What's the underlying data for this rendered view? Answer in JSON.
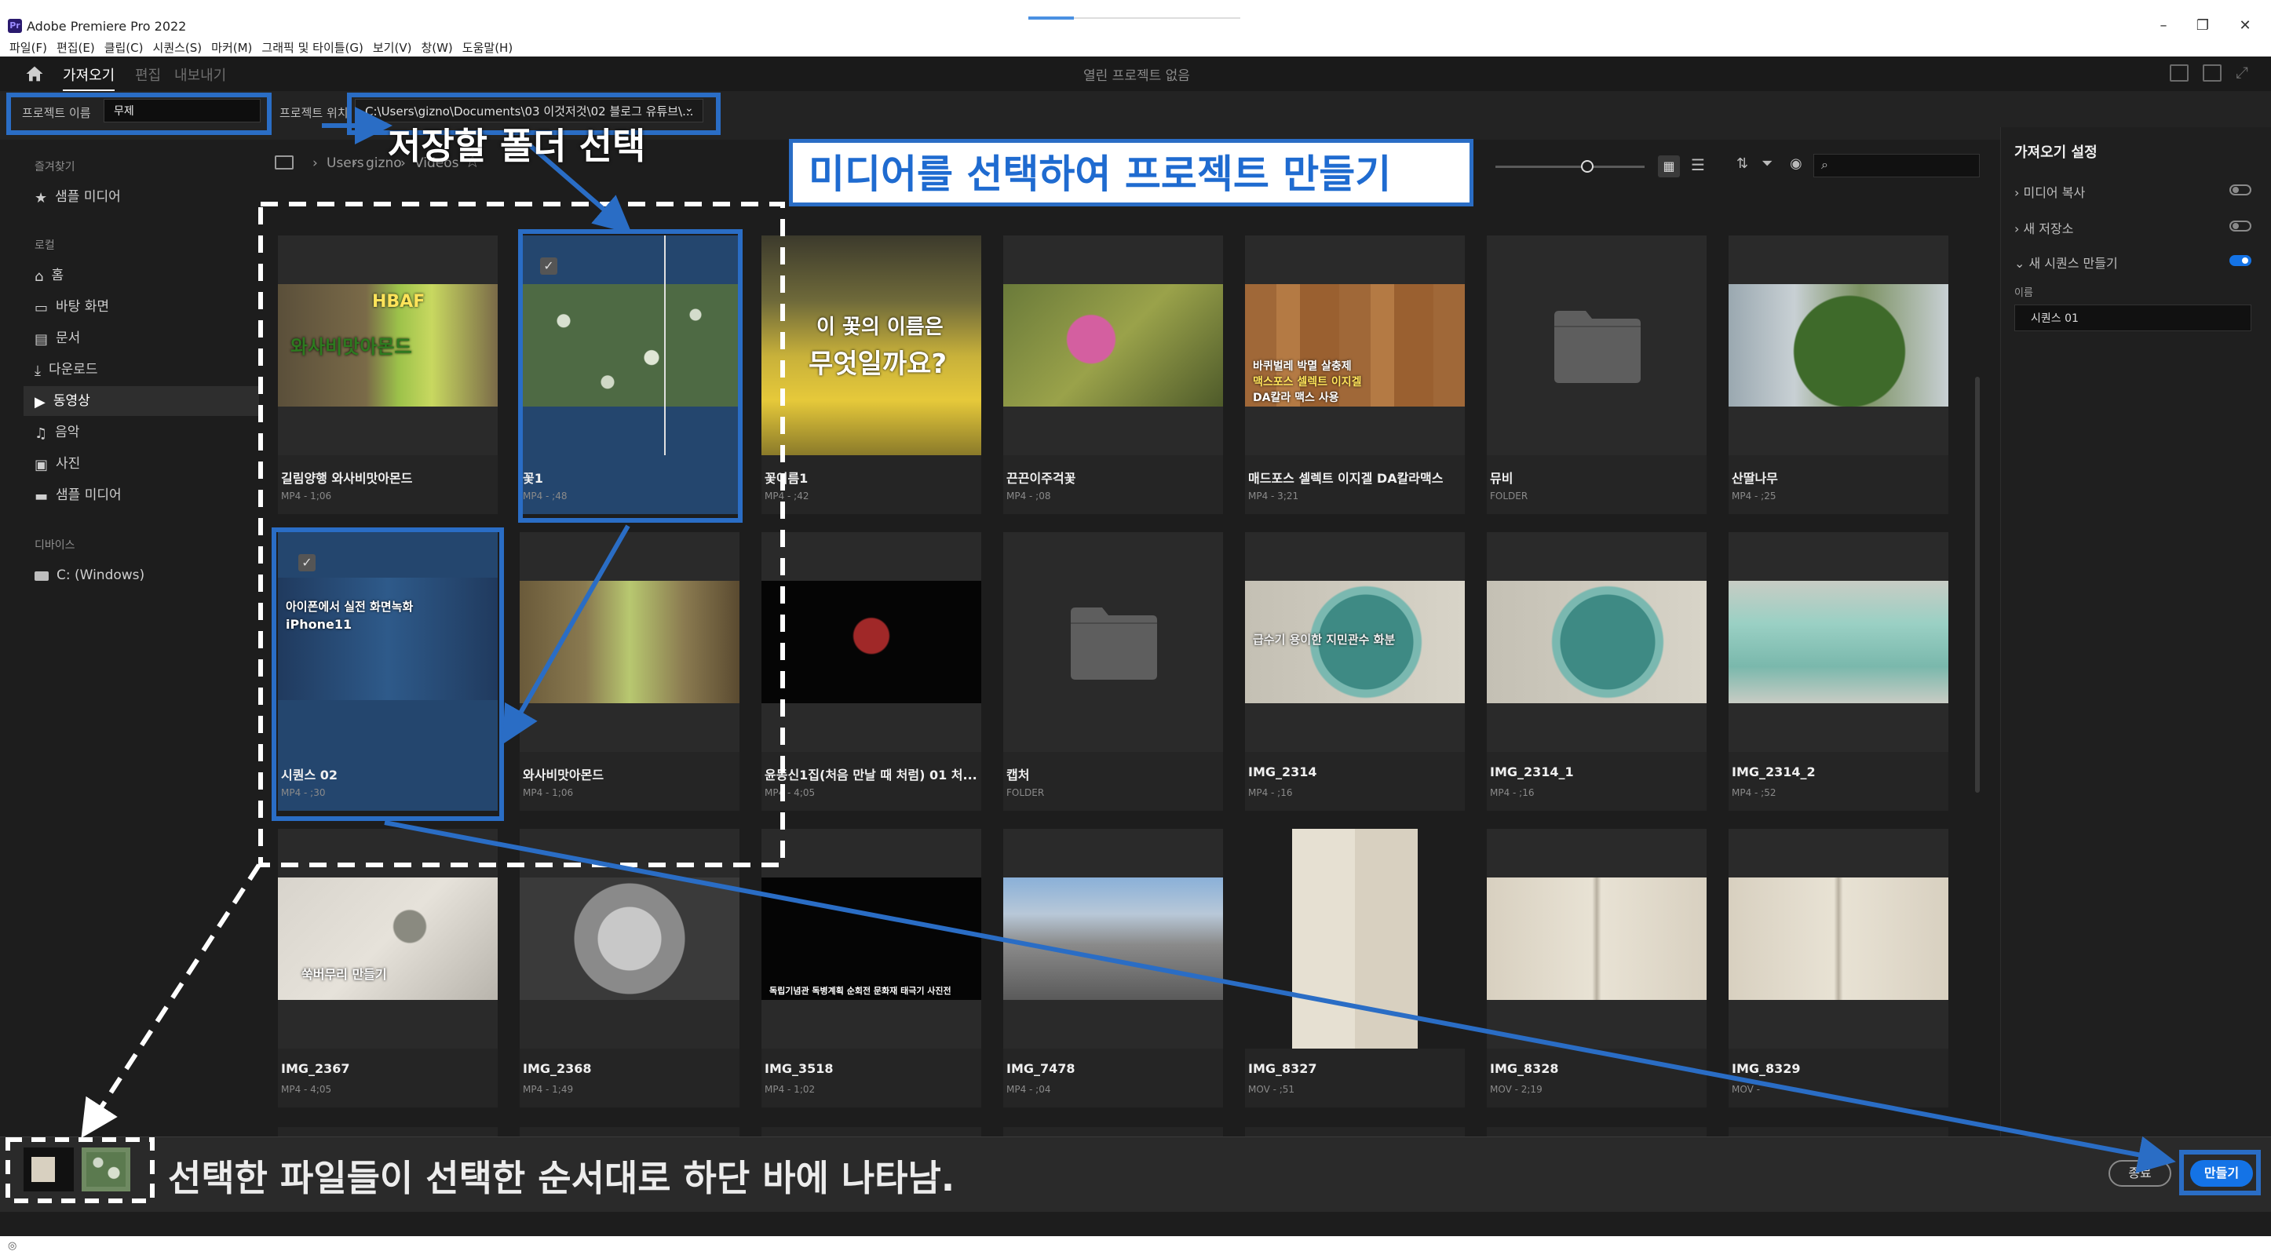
{
  "app": {
    "title": "Adobe Premiere Pro 2022",
    "icon": "Pr"
  },
  "menu": [
    "파일(F)",
    "편집(E)",
    "클립(C)",
    "시퀀스(S)",
    "마커(M)",
    "그래픽 및 타이틀(G)",
    "보기(V)",
    "창(W)",
    "도움말(H)"
  ],
  "header": {
    "tabs": [
      {
        "label": "가져오기",
        "active": true
      },
      {
        "label": "편집",
        "active": false
      },
      {
        "label": "내보내기",
        "active": false
      }
    ],
    "center_title": "열린 프로젝트 없음"
  },
  "project": {
    "name_label": "프로젝트 이름",
    "name_value": "무제",
    "location_label": "프로젝트 위치",
    "location_value": "C:\\Users\\gizno\\Documents\\03 이것저것\\02 블로그 유튜브\\..."
  },
  "sidebar": {
    "favorites_head": "즐겨찾기",
    "favorites": [
      {
        "label": "샘플 미디어",
        "icon": "star-icon"
      }
    ],
    "local_head": "로컬",
    "local": [
      {
        "label": "홈",
        "icon": "home-icon"
      },
      {
        "label": "바탕 화면",
        "icon": "monitor-icon"
      },
      {
        "label": "문서",
        "icon": "document-icon"
      },
      {
        "label": "다운로드",
        "icon": "download-icon"
      },
      {
        "label": "동영상",
        "icon": "video-icon",
        "selected": true
      },
      {
        "label": "음악",
        "icon": "music-icon"
      },
      {
        "label": "사진",
        "icon": "image-icon"
      },
      {
        "label": "샘플 미디어",
        "icon": "folder-icon"
      }
    ],
    "devices_head": "디바이스",
    "devices": [
      {
        "label": "C: (Windows)",
        "icon": "drive-icon"
      }
    ]
  },
  "breadcrumb": [
    "Users",
    "gizno",
    "Videos"
  ],
  "media": [
    {
      "name": "길림양행 와사비맛아몬드",
      "meta": "MP4 - 1;06"
    },
    {
      "name": "꽃1",
      "meta": "MP4 - ;48",
      "selected": true
    },
    {
      "name": "꽃이름1",
      "meta": "MP4 - ;42"
    },
    {
      "name": "끈끈이주걱꽃",
      "meta": "MP4 - ;08"
    },
    {
      "name": "매드포스 셀렉트 이지겔 DA칼라맥스",
      "meta": "MP4 - 3;21"
    },
    {
      "name": "뮤비",
      "meta": "FOLDER"
    },
    {
      "name": "산딸나무",
      "meta": "MP4 - ;25"
    },
    {
      "name": "시퀀스 02",
      "meta": "MP4 - ;30",
      "selected": true
    },
    {
      "name": "와사비맛아몬드",
      "meta": "MP4 - 1;06"
    },
    {
      "name": "윤동신1집(처음 만날 때 처럼) 01 처...",
      "meta": "MP4 - 4;05"
    },
    {
      "name": "캡처",
      "meta": "FOLDER"
    },
    {
      "name": "IMG_2314",
      "meta": "MP4 - ;16"
    },
    {
      "name": "IMG_2314_1",
      "meta": "MP4 - ;16"
    },
    {
      "name": "IMG_2314_2",
      "meta": "MP4 - ;52"
    },
    {
      "name": "IMG_2367",
      "meta": "MP4 - 4;05"
    },
    {
      "name": "IMG_2368",
      "meta": "MP4 - 1;49"
    },
    {
      "name": "IMG_3518",
      "meta": "MP4 - 1;02"
    },
    {
      "name": "IMG_7478",
      "meta": "MP4 - ;04"
    },
    {
      "name": "IMG_8327",
      "meta": "MOV - ;51"
    },
    {
      "name": "IMG_8328",
      "meta": "MOV - 2;19"
    },
    {
      "name": "IMG_8329",
      "meta": "MOV - "
    }
  ],
  "thumb_text": {
    "t1a": "HBAF",
    "t1b": "와사비맛아몬드",
    "t3a": "이 꽃의 이름은",
    "t3b": "무엇일까요?",
    "t5a": "바퀴벌레 박멸 살충제",
    "t5b": "맥스포스 셀렉트 이지겔",
    "t5c": "DA칼라 맥스 사용",
    "t8a": "아이폰에서 실전 화면녹화",
    "t8b": "iPhone11",
    "t12": "급수기 용이한 지민관수 화분",
    "t15": "쑥버무리 만들기",
    "t17": "독립기념관 독병계획 순회전 문화재 태극기 사진전"
  },
  "right_panel": {
    "title": "가져오기 설정",
    "rows": [
      {
        "label": "미디어 복사",
        "on": false
      },
      {
        "label": "새 저장소",
        "on": false
      },
      {
        "label": "새 시퀀스 만들기",
        "on": true
      }
    ],
    "name_label": "이름",
    "seq_name": "시퀀스 01"
  },
  "bottom": {
    "cancel": "종료",
    "create": "만들기"
  },
  "annotations": {
    "folder": "저장할 폴더 선택",
    "title": "미디어를 선택하여 프로젝트 만들기",
    "bottom": "선택한 파일들이 선택한 순서대로 하단 바에 나타남."
  },
  "colors": {
    "accent": "#1473e6",
    "annotation": "#2a6dc5",
    "selected": "#24466e"
  }
}
